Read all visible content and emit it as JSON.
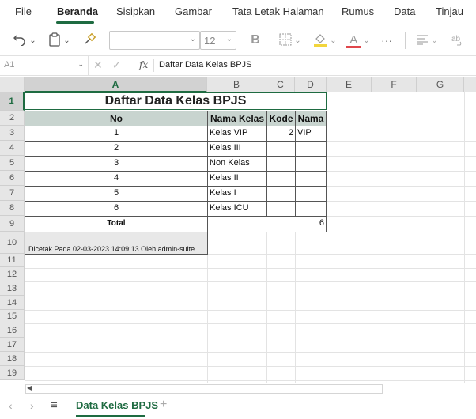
{
  "menu": {
    "tabs": [
      {
        "label": "File"
      },
      {
        "label": "Beranda",
        "active": true
      },
      {
        "label": "Sisipkan"
      },
      {
        "label": "Gambar"
      },
      {
        "label": "Tata Letak Halaman"
      },
      {
        "label": "Rumus"
      },
      {
        "label": "Data"
      },
      {
        "label": "Tinjau"
      }
    ]
  },
  "ribbon": {
    "font_size": "12",
    "bold_label": "B",
    "font_color_label": "A",
    "more_label": "···",
    "accent_color": "#1e6b41",
    "highlight_color": "#f2d53c",
    "font_color": "#e0474c"
  },
  "formula_bar": {
    "name_box": "A1",
    "fx_label": "fx",
    "content": "Daftar Data Kelas BPJS"
  },
  "grid": {
    "columns": [
      "A",
      "B",
      "C",
      "D",
      "E",
      "F",
      "G"
    ],
    "rows": [
      "1",
      "2",
      "3",
      "4",
      "5",
      "6",
      "7",
      "8",
      "9",
      "10",
      "11",
      "12",
      "13",
      "14",
      "15",
      "16",
      "17",
      "18",
      "19"
    ]
  },
  "sheet": {
    "title": "Daftar Data Kelas BPJS",
    "headers": {
      "no": "No",
      "nama_kelas": "Nama Kelas",
      "kode": "Kode",
      "nama": "Nama"
    },
    "rows": [
      {
        "no": "1",
        "nama_kelas": "Kelas VIP",
        "kode": "2",
        "nama": "VIP"
      },
      {
        "no": "2",
        "nama_kelas": "Kelas III",
        "kode": "",
        "nama": ""
      },
      {
        "no": "3",
        "nama_kelas": "Non Kelas",
        "kode": "",
        "nama": ""
      },
      {
        "no": "4",
        "nama_kelas": "Kelas II",
        "kode": "",
        "nama": ""
      },
      {
        "no": "5",
        "nama_kelas": "Kelas I",
        "kode": "",
        "nama": ""
      },
      {
        "no": "6",
        "nama_kelas": "Kelas ICU",
        "kode": "",
        "nama": ""
      }
    ],
    "total_label": "Total",
    "total_value": "6",
    "footer": "Dicetak Pada 02-03-2023 14:09:13 Oleh admin-suite"
  },
  "sheet_tabs": {
    "active": "Data Kelas BPJS",
    "add_label": "+"
  }
}
